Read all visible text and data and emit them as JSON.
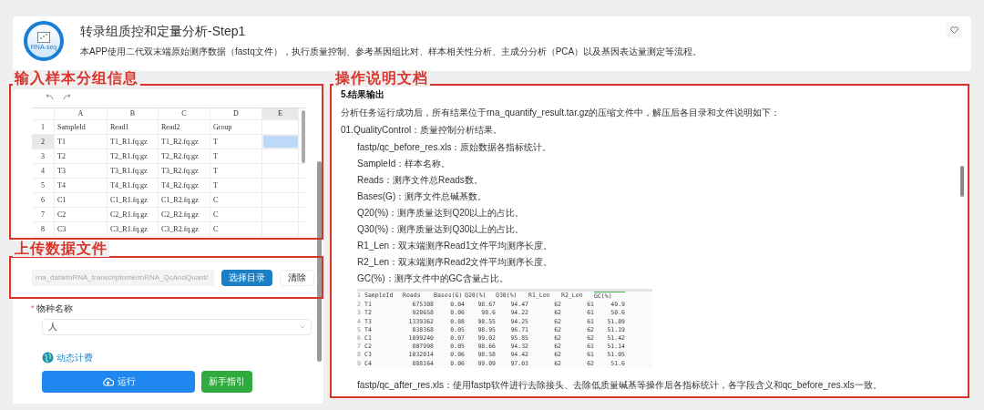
{
  "app": {
    "title": "转录组质控和定量分析-Step1",
    "description": "本APP使用二代双末端原始测序数据（fastq文件），执行质量控制、参考基因组比对、样本相关性分析、主成分分析（PCA）以及基因表达量测定等流程。",
    "logo_text": "RNA-seq"
  },
  "sample_section": {
    "annotation": "输入样本分组信息",
    "columns": [
      "A",
      "B",
      "C",
      "D",
      "E"
    ],
    "rows": [
      {
        "number": "1",
        "cells": [
          "SampleId",
          "Read1",
          "Read2",
          "Group"
        ],
        "e_selected": false
      },
      {
        "number": "2",
        "cells": [
          "T1",
          "T1_R1.fq.gz",
          "T1_R2.fq.gz",
          "T"
        ],
        "e_selected": true
      },
      {
        "number": "3",
        "cells": [
          "T2",
          "T2_R1.fq.gz",
          "T2_R2.fq.gz",
          "T"
        ],
        "e_selected": false
      },
      {
        "number": "4",
        "cells": [
          "T3",
          "T3_R1.fq.gz",
          "T3_R2.fq.gz",
          "T"
        ],
        "e_selected": false
      },
      {
        "number": "5",
        "cells": [
          "T4",
          "T4_R1.fq.gz",
          "T4_R2.fq.gz",
          "T"
        ],
        "e_selected": false
      },
      {
        "number": "6",
        "cells": [
          "C1",
          "C1_R1.fq.gz",
          "C1_R2.fq.gz",
          "C"
        ],
        "e_selected": false
      },
      {
        "number": "7",
        "cells": [
          "C2",
          "C2_R1.fq.gz",
          "C2_R2.fq.gz",
          "C"
        ],
        "e_selected": false
      },
      {
        "number": "8",
        "cells": [
          "C3",
          "C3_R1.fq.gz",
          "C3_R2.fq.gz",
          "C"
        ],
        "e_selected": false
      }
    ]
  },
  "upload_section": {
    "annotation": "上传数据文件",
    "path": "rna_data/mRNA_transcriptome/mRNA_QcAndQuant/",
    "choose_button": "选择目录",
    "clear_button": "清除"
  },
  "species": {
    "required_mark": "*",
    "label": "物种名称",
    "value": "人"
  },
  "billing_link": "动态计费",
  "run_button": "运行",
  "guide_button": "新手指引",
  "doc": {
    "annotation": "操作说明文档",
    "blocks": [
      {
        "kind": "heading",
        "text": "5.结果输出"
      },
      {
        "kind": "paragraph",
        "text": "分析任务运行成功后，所有结果位于rna_quantify_result.tar.gz的压缩文件中，解压后各目录和文件说明如下："
      },
      {
        "kind": "paragraph",
        "text": "01.QualityControl：质量控制分析结果。"
      },
      {
        "kind": "item",
        "text": "fastp/qc_before_res.xls：原始数据各指标统计。"
      },
      {
        "kind": "item",
        "text": "SampleId：样本名称。"
      },
      {
        "kind": "item",
        "text": "Reads：测序文件总Reads数。"
      },
      {
        "kind": "item",
        "text": "Bases(G)：测序文件总碱基数。"
      },
      {
        "kind": "item",
        "text": "Q20(%)：测序质量达到Q20以上的占比。"
      },
      {
        "kind": "item",
        "text": "Q30(%)：测序质量达到Q30以上的占比。"
      },
      {
        "kind": "item",
        "text": "R1_Len：双末端测序Read1文件平均测序长度。"
      },
      {
        "kind": "item",
        "text": "R2_Len：双末端测序Read2文件平均测序长度。"
      },
      {
        "kind": "item",
        "text": "GC(%)：测序文件中的GC含量占比。"
      },
      {
        "kind": "table",
        "header": {
          "number": "1",
          "cells": [
            "SampleId",
            "Reads",
            "Bases(G)",
            "Q20(%)",
            "Q30(%)",
            "R1_Len",
            "R2_Len",
            "GC(%)"
          ]
        },
        "rows": [
          {
            "number": "2",
            "cells": [
              "T1",
              "675308",
              "0.04",
              "98.67",
              "94.47",
              "62",
              "61",
              "49.9"
            ]
          },
          {
            "number": "3",
            "cells": [
              "T2",
              "928658",
              "0.06",
              "98.6",
              "94.22",
              "62",
              "61",
              "50.6"
            ]
          },
          {
            "number": "4",
            "cells": [
              "T3",
              "1339362",
              "0.08",
              "98.55",
              "94.25",
              "62",
              "61",
              "51.09"
            ]
          },
          {
            "number": "5",
            "cells": [
              "T4",
              "838368",
              "0.05",
              "98.95",
              "96.71",
              "62",
              "62",
              "51.19"
            ]
          },
          {
            "number": "6",
            "cells": [
              "C1",
              "1099240",
              "0.07",
              "99.02",
              "95.85",
              "62",
              "62",
              "51.42"
            ]
          },
          {
            "number": "7",
            "cells": [
              "C2",
              "807998",
              "0.05",
              "98.66",
              "94.32",
              "62",
              "61",
              "51.14"
            ]
          },
          {
            "number": "8",
            "cells": [
              "C3",
              "1032014",
              "0.06",
              "98.58",
              "94.42",
              "62",
              "61",
              "51.05"
            ]
          },
          {
            "number": "9",
            "cells": [
              "C4",
              "888164",
              "0.06",
              "99.09",
              "97.03",
              "62",
              "62",
              "51.6"
            ]
          }
        ]
      },
      {
        "kind": "item",
        "text": "fastp/qc_after_res.xls：使用fastp软件进行去除接头、去除低质量碱基等操作后各指标统计，各字段含义和qc_before_res.xls一致。"
      }
    ]
  }
}
